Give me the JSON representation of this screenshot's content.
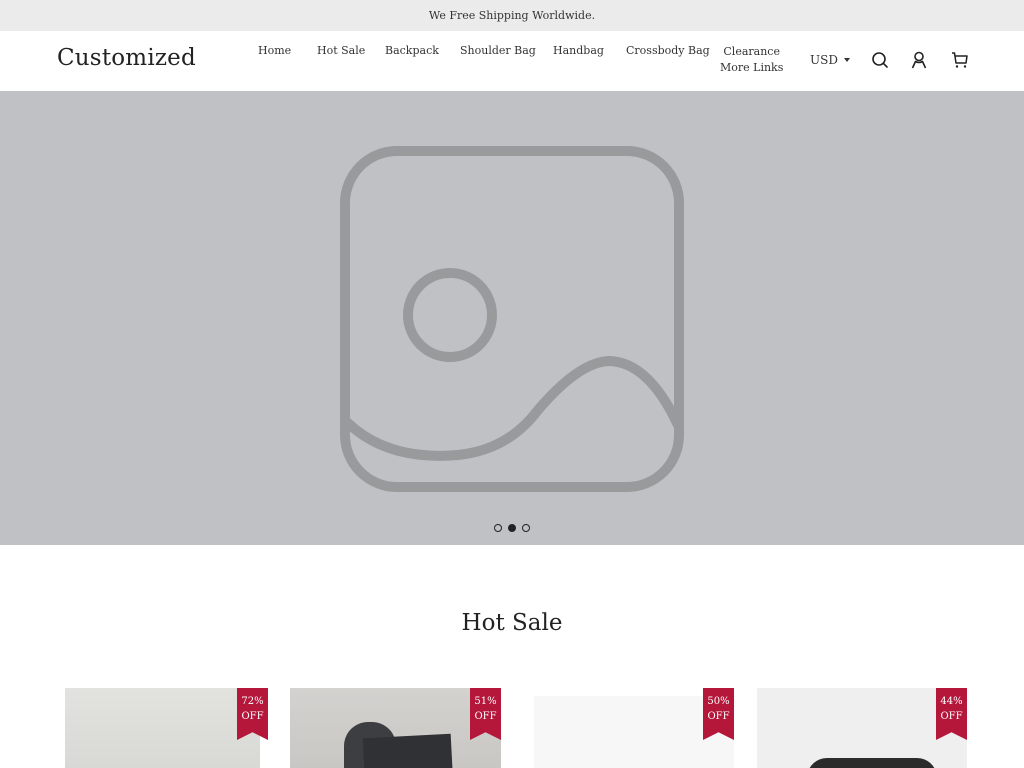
{
  "announcement": "We Free Shipping Worldwide.",
  "header": {
    "logo": "Customized",
    "nav": [
      {
        "label": "Home"
      },
      {
        "label": "Hot Sale"
      },
      {
        "label": "Backpack"
      },
      {
        "label": "Shoulder Bag"
      },
      {
        "label": "Handbag"
      },
      {
        "label": "Crossbody Bag"
      },
      {
        "label": "Clearance"
      },
      {
        "label": "More Links"
      }
    ],
    "currency": "USD",
    "icons": [
      "search-icon",
      "account-icon",
      "cart-icon"
    ]
  },
  "hero": {
    "image": "image-placeholder-icon",
    "slides": 3,
    "active_slide": 2
  },
  "hot_sale": {
    "title": "Hot Sale",
    "products": [
      {
        "discount_pct": "72%",
        "discount_label": "OFF"
      },
      {
        "discount_pct": "51%",
        "discount_label": "OFF"
      },
      {
        "discount_pct": "50%",
        "discount_label": "OFF"
      },
      {
        "discount_pct": "44%",
        "discount_label": "OFF"
      }
    ]
  },
  "colors": {
    "announcement_bg": "#ebebeb",
    "hero_bg": "#c0c1c4",
    "badge": "#b5173b"
  }
}
